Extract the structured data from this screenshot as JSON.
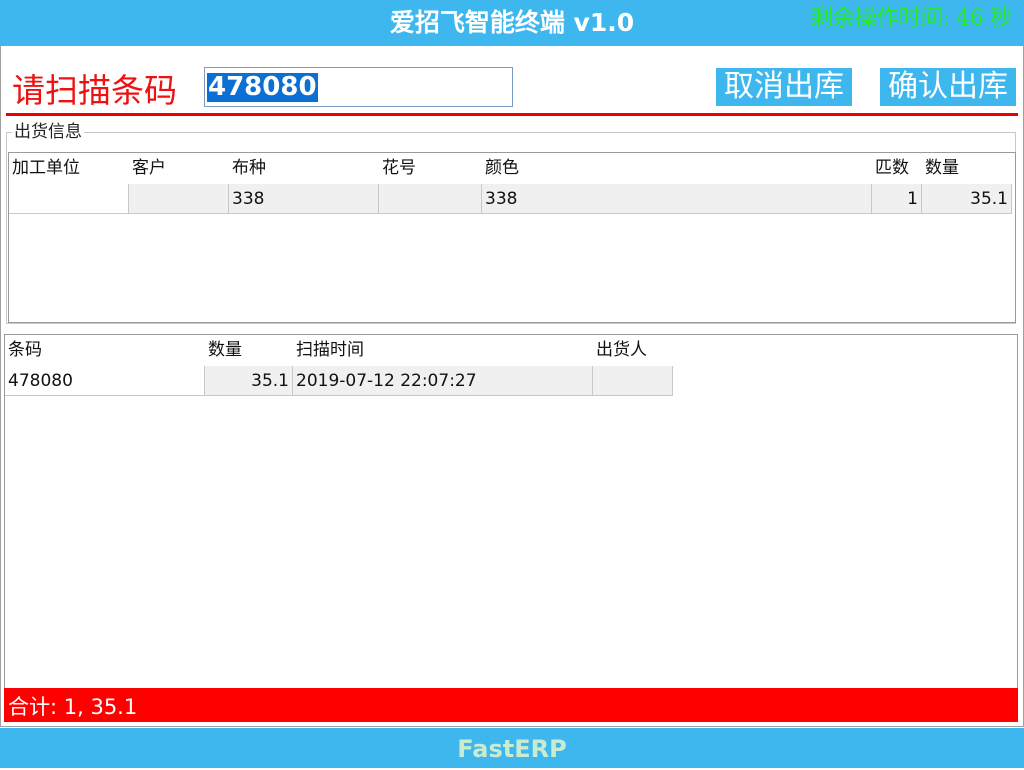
{
  "titlebar": {
    "app_title": "爱招飞智能终端 v1.0",
    "timer_label": "剩余操作时间:",
    "timer_value": "46",
    "timer_unit": "秒"
  },
  "scan": {
    "label": "请扫描条码",
    "value": "478080"
  },
  "actions": {
    "cancel_label": "取消出库",
    "confirm_label": "确认出库"
  },
  "shipment_info": {
    "legend": "出货信息",
    "columns": [
      "加工单位",
      "客户",
      "布种",
      "花号",
      "颜色",
      "匹数",
      "数量"
    ],
    "rows": [
      [
        "",
        "",
        "338",
        "",
        "338",
        "1",
        "35.1"
      ]
    ]
  },
  "scan_list": {
    "columns": [
      "条码",
      "数量",
      "扫描时间",
      "出货人"
    ],
    "rows": [
      [
        "478080",
        "35.1",
        "2019-07-12 22:07:27",
        ""
      ]
    ]
  },
  "summary": {
    "text": "合计: 1,   35.1"
  },
  "footer": {
    "brand": "FastERP"
  },
  "colors": {
    "accent": "#3db7ee",
    "alert": "#ff0000",
    "timer": "#22ee22"
  }
}
